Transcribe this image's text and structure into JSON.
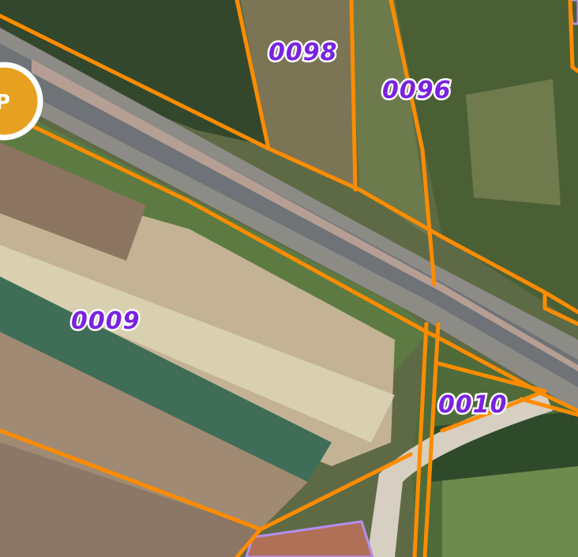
{
  "map": {
    "type": "cadastral-parcel-map-over-satellite-imagery",
    "parcel_labels": [
      {
        "id": "parcel-0098",
        "text": "0098"
      },
      {
        "id": "parcel-0096",
        "text": "0096"
      },
      {
        "id": "parcel-0009",
        "text": "0009"
      },
      {
        "id": "parcel-0010",
        "text": "0010"
      }
    ],
    "badge": {
      "glyph": "P",
      "icon": "location-marker-icon"
    },
    "colors": {
      "boundary": "#ff8c00",
      "label_text": "#7a22e0",
      "label_halo": "#ffffff",
      "highlight_outline": "#b48ef0",
      "badge_fill": "#e8a020",
      "road": "#7b7d80",
      "field_bare": "#c9b797",
      "crop_green": "#3f6d57",
      "vegetation": "#4a6a3a"
    }
  }
}
